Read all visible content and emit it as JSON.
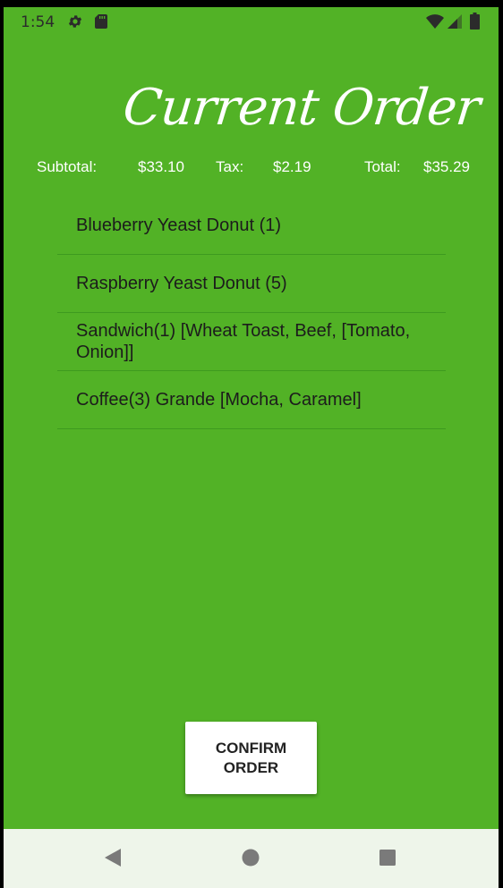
{
  "status_bar": {
    "time": "1:54",
    "icons": [
      "gear-icon",
      "sd-card-icon",
      "wifi-icon",
      "signal-icon",
      "battery-icon"
    ]
  },
  "header": {
    "title": "Current Order"
  },
  "totals": {
    "subtotal_label": "Subtotal:",
    "subtotal_value": "$33.10",
    "tax_label": "Tax:",
    "tax_value": "$2.19",
    "total_label": "Total:",
    "total_value": "$35.29"
  },
  "order_items": [
    "Blueberry Yeast Donut (1)",
    "Raspberry Yeast Donut (5)",
    "Sandwich(1) [Wheat Toast, Beef, [Tomato, Onion]]",
    "Coffee(3) Grande [Mocha, Caramel]"
  ],
  "confirm_button": {
    "label": "CONFIRM ORDER"
  },
  "nav_bar": {
    "icons": [
      "back-icon",
      "home-icon",
      "recents-icon"
    ]
  },
  "colors": {
    "background": "#52b226",
    "divider": "#3e9a1f",
    "nav_background": "#eef5ea",
    "button_background": "#ffffff",
    "text_dark": "#1c1c1c",
    "text_light": "#ffffff"
  }
}
